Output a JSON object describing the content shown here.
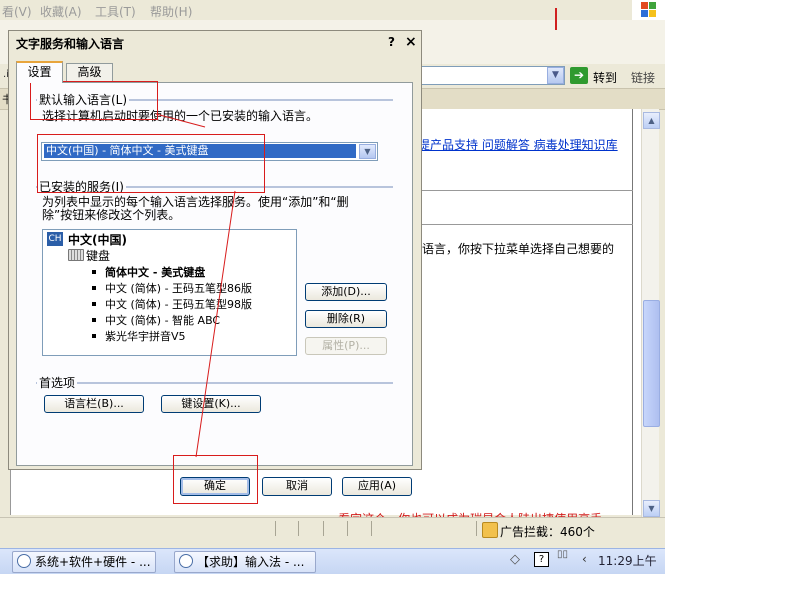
{
  "ie": {
    "menu": [
      "看(V)",
      "收藏(A)",
      "工具(T)",
      "帮助(H)"
    ],
    "go_label": "转到",
    "links_label": "链接",
    "addr_fragment": ".i",
    "toolbar_fragment": "书",
    "links_text": "提产品支持  问题解答  病毒处理知识库",
    "body_text": "语言，你按下拉菜单选择自己想要的",
    "red_text": "- 看完这个，你也可以成为瑞星会人陆出捷使用高手 -",
    "status_adblock": "广告拦截：460个"
  },
  "taskbar": {
    "task1": "系统+软件+硬件 - ...",
    "task2": "【求助】输入法 - ...",
    "clock": "11:29上午",
    "help_glyph": "?"
  },
  "dialog": {
    "title": "文字服务和输入语言",
    "help": "?",
    "close": "×",
    "tabs": [
      "设置",
      "高级"
    ],
    "default_lang": {
      "label": "默认输入语言(L)",
      "desc": "选择计算机启动时要使用的一个已安装的输入语言。",
      "selected": "中文(中国) - 简体中文 - 美式键盘"
    },
    "installed": {
      "label": "已安装的服务(I)",
      "desc_line1": "为列表中显示的每个输入语言选择服务。使用“添加”和“删",
      "desc_line2": "除”按钮来修改这个列表。",
      "root": "中文(中国)",
      "root_badge": "CH",
      "keyboard": "键盘",
      "items": [
        "简体中文 - 美式键盘",
        "中文 (简体) - 王码五笔型86版",
        "中文 (简体) - 王码五笔型98版",
        "中文 (简体) - 智能 ABC",
        "紫光华宇拼音V5"
      ],
      "buttons": {
        "add": "添加(D)...",
        "remove": "删除(R)",
        "properties": "属性(P)..."
      }
    },
    "prefs": {
      "label": "首选项",
      "language_bar": "语言栏(B)...",
      "key_settings": "键设置(K)..."
    },
    "footer": {
      "ok": "确定",
      "cancel": "取消",
      "apply": "应用(A)"
    }
  },
  "colors": {
    "annotation_red": "#d81c1c",
    "selection_blue": "#316ac5",
    "xp_face": "#ece9d8"
  }
}
